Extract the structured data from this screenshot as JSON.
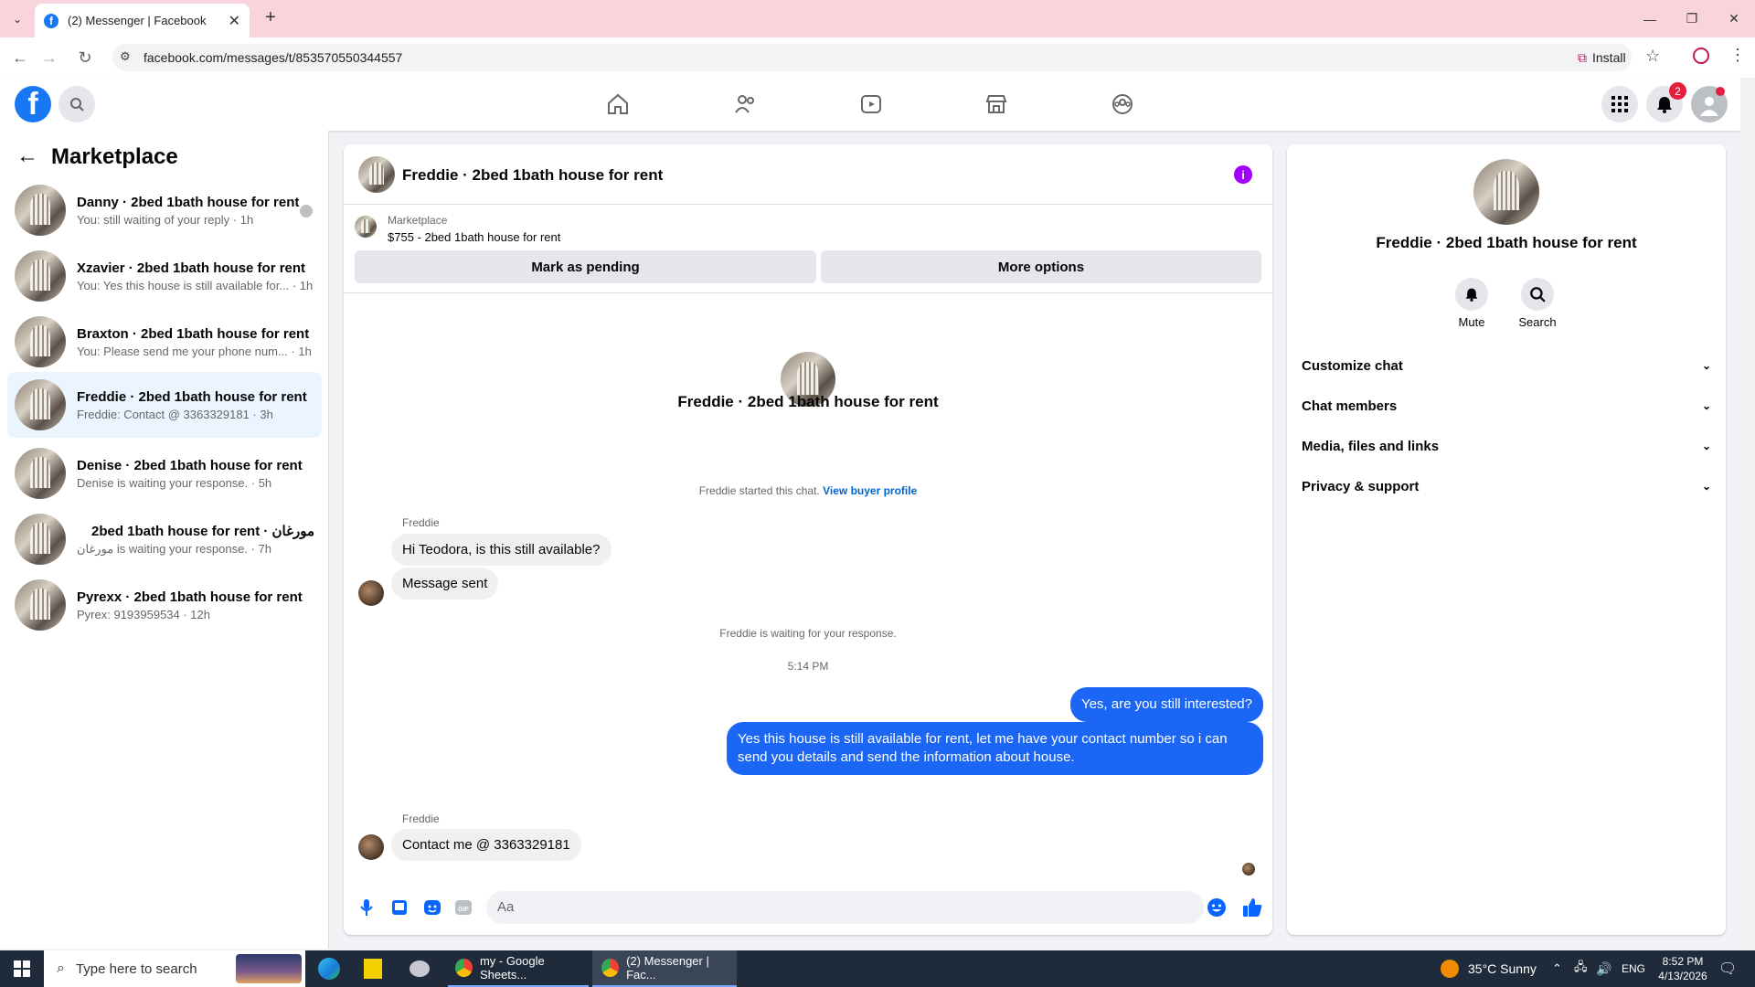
{
  "browser": {
    "tab_title": "(2) Messenger | Facebook",
    "url": "facebook.com/messages/t/853570550344557",
    "install_label": "Install"
  },
  "fb_header": {
    "notification_count": "2"
  },
  "left": {
    "title": "Marketplace",
    "conversations": [
      {
        "name": "Danny · 2bed 1bath house for rent",
        "sub": "You: still waiting of your reply · 1h"
      },
      {
        "name": "Xzavier · 2bed 1bath house for rent",
        "sub": "You: Yes this house is still available for... · 1h"
      },
      {
        "name": "Braxton · 2bed 1bath house for rent",
        "sub": "You: Please send me your phone num... · 1h"
      },
      {
        "name": "Freddie · 2bed 1bath house for rent",
        "sub": "Freddie: Contact @ 3363329181 · 3h"
      },
      {
        "name": "Denise · 2bed 1bath house for rent",
        "sub": "Denise is waiting your response. · 5h"
      },
      {
        "name": "2bed 1bath house for rent · مورغان",
        "sub": "مورغان is waiting your response. · 7h"
      },
      {
        "name": "Pyrexx · 2bed 1bath house for rent",
        "sub": "Pyrex: 9193959534 · 12h"
      }
    ]
  },
  "chat": {
    "header_title": "Freddie · 2bed 1bath house for rent",
    "listing_source": "Marketplace",
    "listing_title": "$755 - 2bed 1bath house for rent",
    "mark_pending": "Mark as pending",
    "more_options": "More options",
    "profile_name": "Freddie · 2bed 1bath house for rent",
    "started_text": "Freddie started this chat.",
    "view_buyer": "View buyer profile",
    "sender1": "Freddie",
    "msg1": "Hi Teodora, is this still available?",
    "msg2": "Message sent",
    "waiting": "Freddie is waiting for your response.",
    "time": "5:14 PM",
    "out1": "Yes, are you still interested?",
    "out2": "Yes this house is still available for rent, let me have your contact number so i can send you details and send the information about house.",
    "sender2": "Freddie",
    "msg3": "Contact me @ 3363329181",
    "input_placeholder": "Aa"
  },
  "right": {
    "name": "Freddie · 2bed 1bath house for rent",
    "mute": "Mute",
    "search": "Search",
    "sections": [
      "Customize chat",
      "Chat members",
      "Media, files and links",
      "Privacy & support"
    ]
  },
  "taskbar": {
    "search_placeholder": "Type here to search",
    "app1": "my - Google Sheets...",
    "app2": "(2) Messenger | Fac...",
    "weather": "35°C  Sunny",
    "lang": "ENG",
    "time": "8:52 PM",
    "date": "4/13/2026"
  }
}
